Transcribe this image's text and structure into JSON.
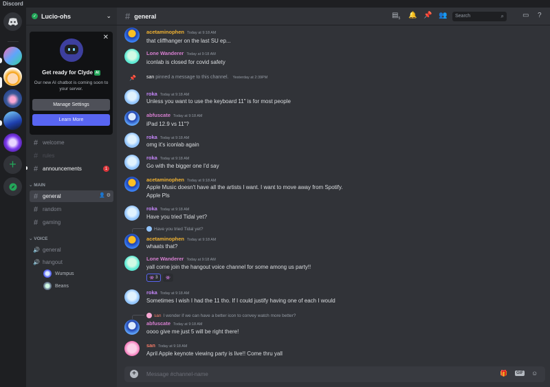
{
  "window": {
    "title": "Discord"
  },
  "server": {
    "name": "Lucio-ohs"
  },
  "promo": {
    "title": "Get ready for Clyde",
    "ai_badge": "AI",
    "desc": "Our new AI chatbot is coming soon to your server.",
    "manage_label": "Manage Settings",
    "learn_label": "Learn More"
  },
  "channels_top": [
    {
      "name": "welcome"
    },
    {
      "name": "rules"
    },
    {
      "name": "announcements",
      "badge": "1"
    }
  ],
  "categories": {
    "main": "MAIN",
    "voice": "VOICE"
  },
  "main_channels": [
    {
      "name": "general"
    },
    {
      "name": "random"
    },
    {
      "name": "gaming"
    }
  ],
  "voice_channels": [
    {
      "name": "general"
    },
    {
      "name": "hangout"
    }
  ],
  "voice_users": [
    {
      "name": "Wumpus"
    },
    {
      "name": "Beans"
    }
  ],
  "header": {
    "channel": "general",
    "inbox_count": "5",
    "search_placeholder": "Search"
  },
  "messages": [
    {
      "user": "acetaminophen",
      "ts": "Today at 9:18 AM",
      "text": "that cliffhanger on the last SU ep..."
    },
    {
      "user": "Lone Wanderer",
      "ts": "Today at 9:18 AM",
      "text": "iconlab is closed for covid safety"
    },
    {
      "sys_user": "san",
      "sys_text": "pinned a message to this channel.",
      "sys_ts": "Yesterday at 2:39PM"
    },
    {
      "user": "roka",
      "ts": "Today at 9:18 AM",
      "text": "Unless you want to use the keyboard 11\" is for most people"
    },
    {
      "user": "abfuscate",
      "ts": "Today at 9:18 AM",
      "text": "iPad 12.9 vs 11\"?"
    },
    {
      "user": "roka",
      "ts": "Today at 9:18 AM",
      "text": "omg it's iconlab again"
    },
    {
      "user": "roka",
      "ts": "Today at 9:18 AM",
      "text": "Go with the bigger one I'd say"
    },
    {
      "user": "acetaminophen",
      "ts": "Today at 9:18 AM",
      "text": "Apple Music doesn't have all the artists I want. I want to move away from Spotify.",
      "text2": "Apple Pls"
    },
    {
      "user": "roka",
      "ts": "Today at 9:18 AM",
      "text": "Have you tried Tidal yet?"
    },
    {
      "user": "acetaminophen",
      "ts": "Today at 9:18 AM",
      "text": "whaats that?",
      "reply": "Have you tried Tidal yet?"
    },
    {
      "user": "Lone Wanderer",
      "ts": "Today at 9:18 AM",
      "text": "yall come join the hangout voice channel for some among us party!!",
      "reaction_count": "3"
    },
    {
      "user": "roka",
      "ts": "Today at 9:18 AM",
      "text": "Sometimes I wish I had the 11 tho. If I could justify having one of each I would"
    },
    {
      "user": "abfuscate",
      "ts": "Today at 9:18 AM",
      "text": "oooo give me just 5 will be right there!",
      "reply_user": "san",
      "reply": "I wonder if we can have a better icon to convey watch more better?"
    },
    {
      "user": "san",
      "ts": "Today at 9:18 AM",
      "text": "April Apple keynote viewing party is live!! Come thru yall"
    }
  ],
  "composer": {
    "placeholder": "Message #channel-name",
    "gif_label": "GIF"
  },
  "colors": {
    "blurple": "#5865f2",
    "green": "#23a559",
    "red": "#da373c"
  }
}
